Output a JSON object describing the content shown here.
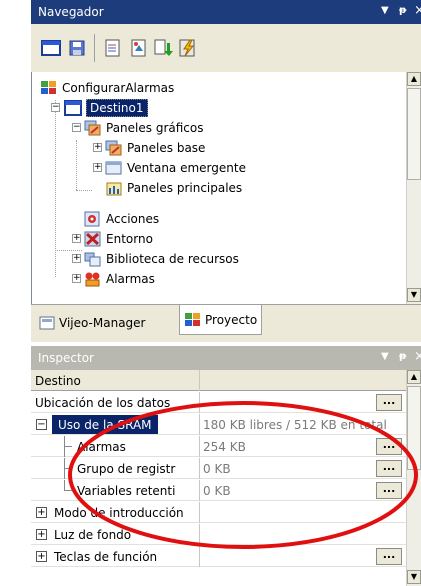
{
  "navigator": {
    "title": "Navegador",
    "controls": {
      "dropdown": "▼",
      "pin": "ᵽ",
      "close": "×"
    },
    "toolbar_icons": [
      "window-icon",
      "save-icon",
      "edit-icon",
      "properties-icon",
      "import-icon",
      "flash-icon"
    ],
    "tree": {
      "root": "ConfigurarAlarmas",
      "destino": "Destino1",
      "paneles_graficos": "Paneles gráficos",
      "paneles_base": "Paneles base",
      "ventana_emergente": "Ventana emergente",
      "paneles_principales": "Paneles principales",
      "acciones": "Acciones",
      "entorno": "Entorno",
      "biblioteca": "Biblioteca de recursos",
      "alarmas": "Alarmas"
    },
    "tabs": {
      "vijeo_manager": "Vijeo-Manager",
      "proyecto": "Proyecto"
    }
  },
  "inspector": {
    "title": "Inspector",
    "controls": {
      "dropdown": "▼",
      "pin": "ᵽ",
      "close": "×"
    },
    "header": "Destino",
    "rows": {
      "ubicacion": {
        "name": "Ubicación de los datos",
        "value": ""
      },
      "sram": {
        "name": "Uso de la SRAM",
        "value": "180 KB libres / 512 KB en total"
      },
      "alarmas": {
        "name": "Alarmas",
        "value": "254 KB"
      },
      "grupo": {
        "name": "Grupo de registr",
        "value": "0 KB"
      },
      "variables": {
        "name": "Variables retenti",
        "value": "0 KB"
      },
      "modo": {
        "name": "Modo de introducción",
        "value": ""
      },
      "luz": {
        "name": "Luz de fondo",
        "value": ""
      },
      "teclas": {
        "name": "Teclas de función",
        "value": ""
      }
    },
    "ellipsis": "...",
    "expand_plus": "+",
    "collapse_minus": "−"
  },
  "colors": {
    "active_title": "#1c3c7c",
    "inactive_title": "#b8b8b0",
    "selection": "#0a246a",
    "highlight_ellipse": "#e01010"
  }
}
